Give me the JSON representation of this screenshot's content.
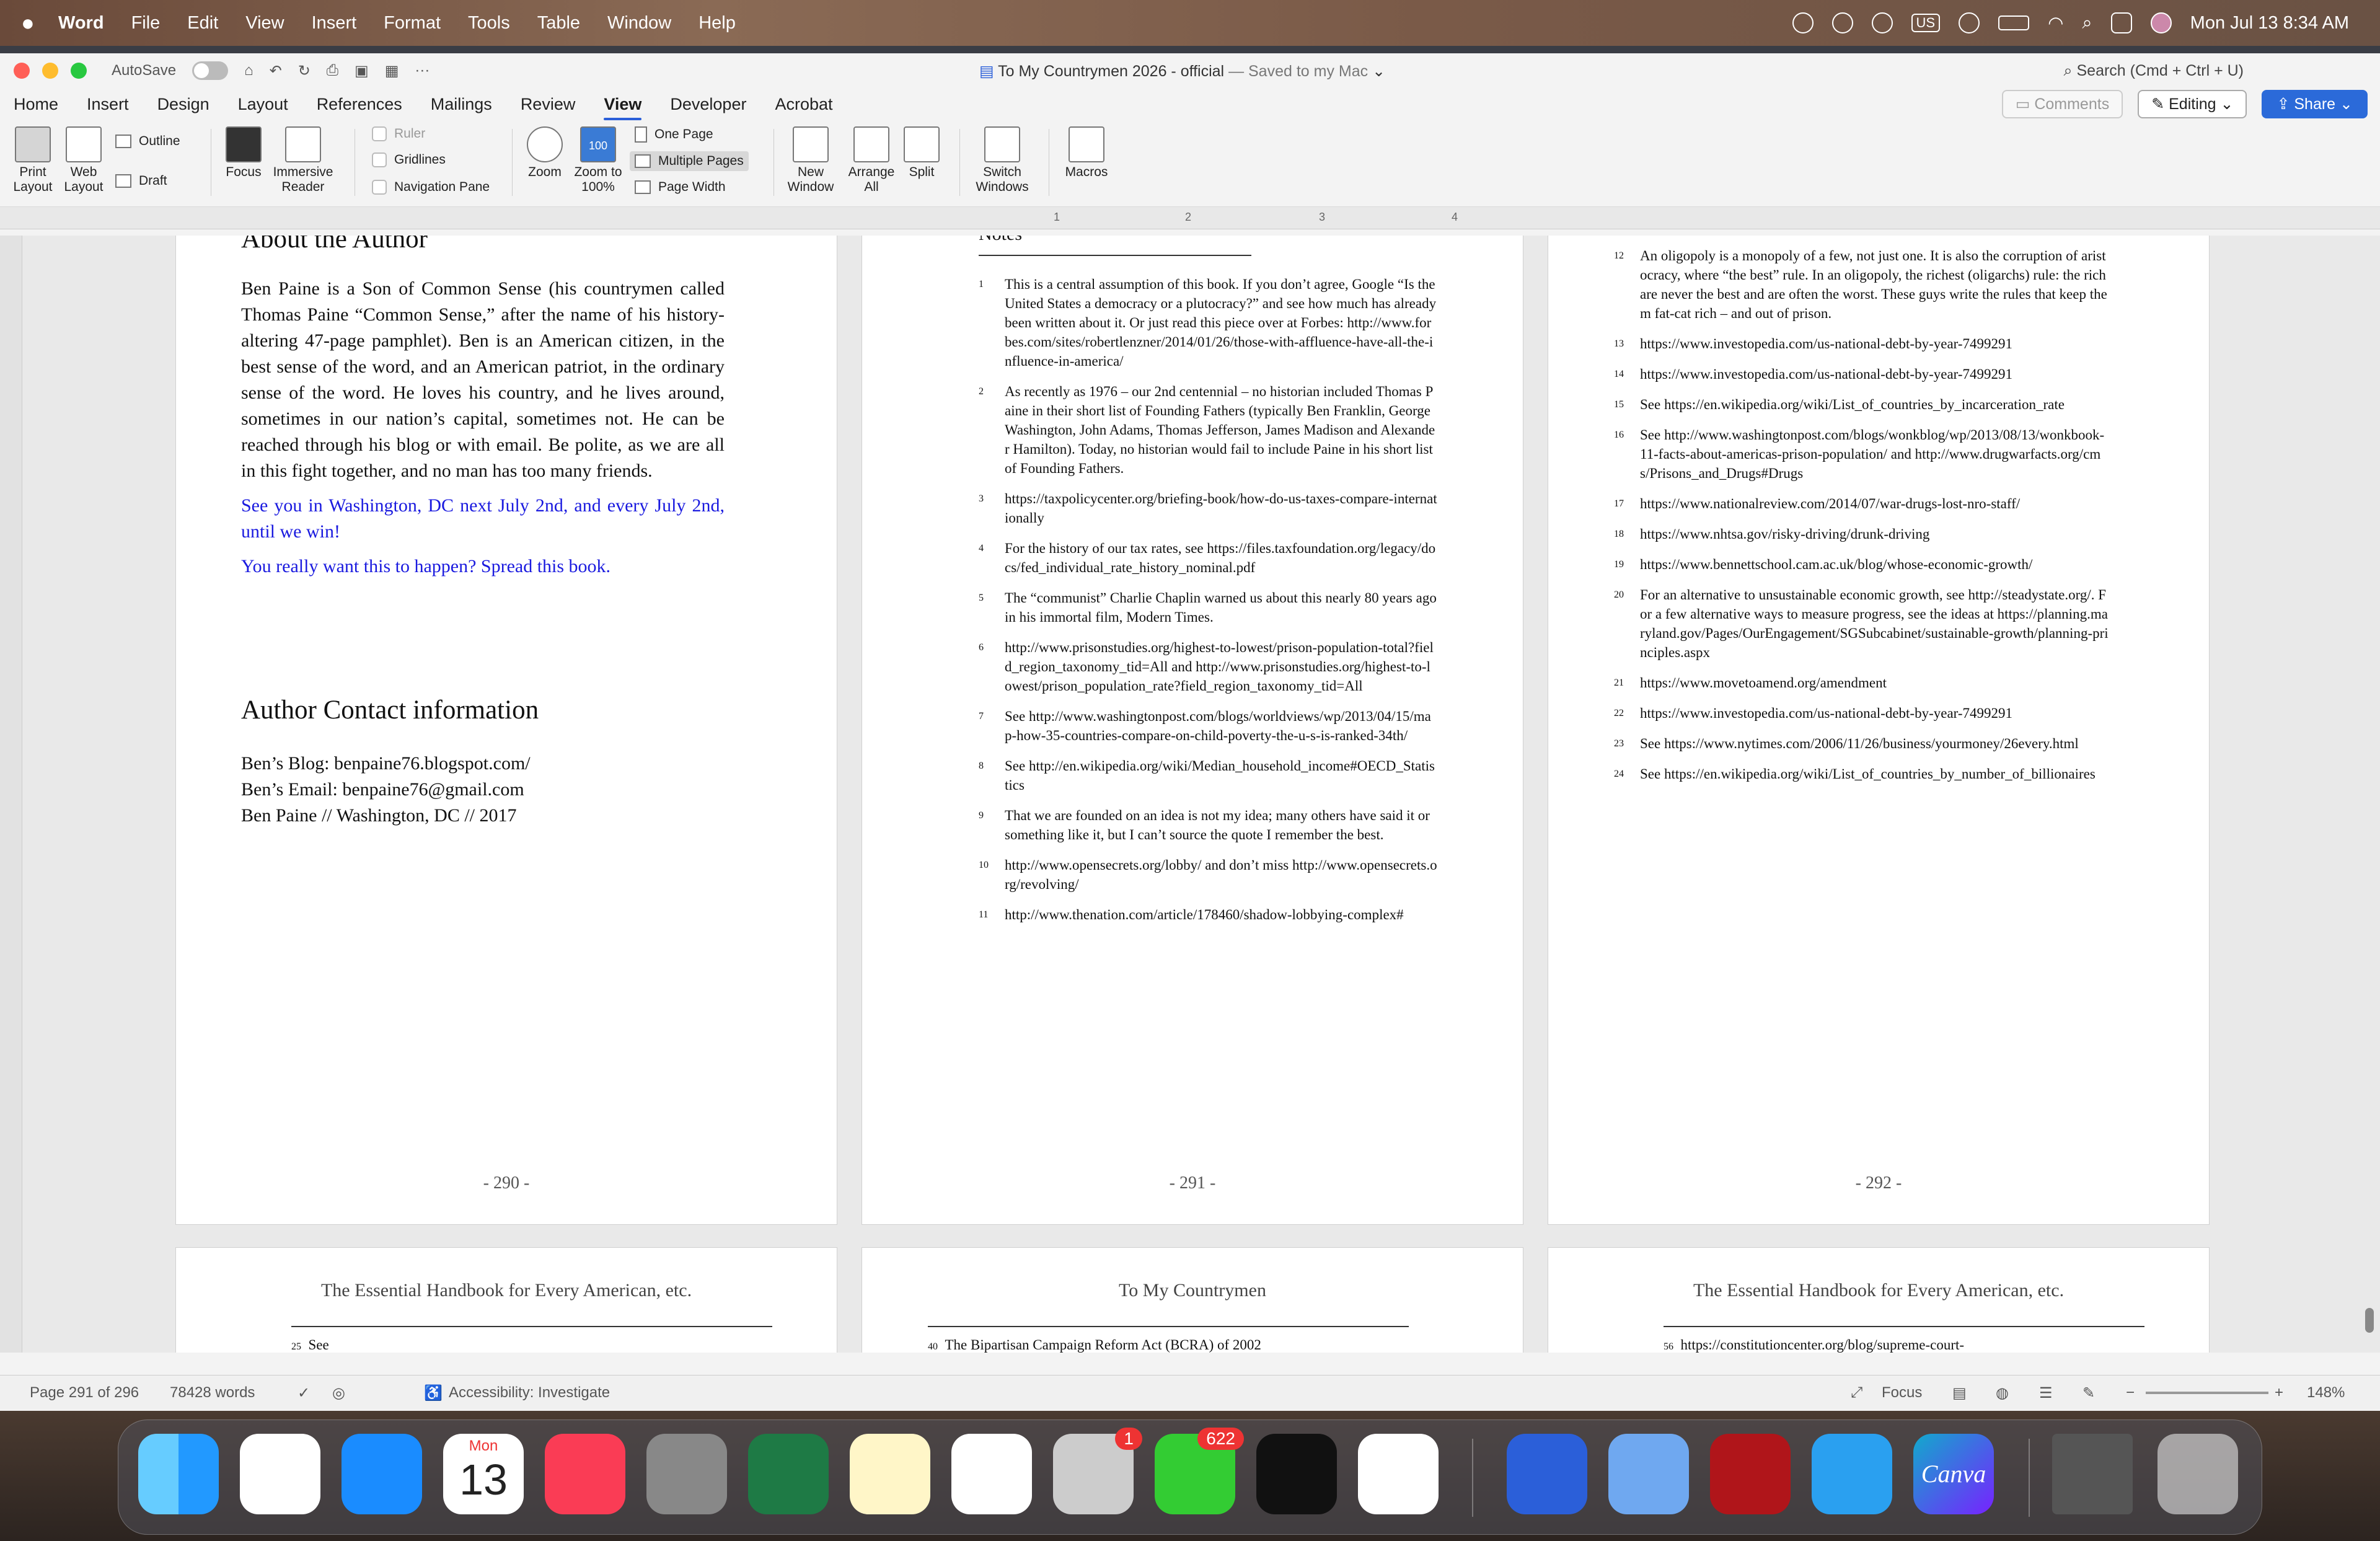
{
  "menubar": {
    "app": "Word",
    "items": [
      "File",
      "Edit",
      "View",
      "Insert",
      "Format",
      "Tools",
      "Table",
      "Window",
      "Help"
    ],
    "input": "US",
    "datetime": "Mon Jul 13  8:34 AM"
  },
  "titlebar": {
    "autosave": "AutoSave",
    "title": "To My Countrymen 2026 - official",
    "saved": "— Saved to my Mac",
    "search": "Search (Cmd + Ctrl + U)"
  },
  "tabs": [
    "Home",
    "Insert",
    "Design",
    "Layout",
    "References",
    "Mailings",
    "Review",
    "View",
    "Developer",
    "Acrobat"
  ],
  "active_tab": "View",
  "tab_buttons": {
    "comments": "Comments",
    "editing": "Editing",
    "share": "Share"
  },
  "ribbon": {
    "print_layout": "Print Layout",
    "web_layout": "Web Layout",
    "outline": "Outline",
    "draft": "Draft",
    "focus": "Focus",
    "immersive": "Immersive Reader",
    "ruler": "Ruler",
    "gridlines": "Gridlines",
    "navigation": "Navigation Pane",
    "zoom": "Zoom",
    "zoom100": "Zoom to 100%",
    "zoom100_icon_text": "100",
    "one_page": "One Page",
    "multiple_pages": "Multiple Pages",
    "page_width": "Page Width",
    "new_window": "New Window",
    "arrange_all": "Arrange All",
    "split": "Split",
    "switch_windows": "Switch Windows",
    "macros": "Macros"
  },
  "ruler_marks": [
    "1",
    "2",
    "3",
    "4"
  ],
  "page290": {
    "heading1": "About the Author",
    "body": "Ben Paine is a Son of Common Sense (his countrymen called Thomas Paine “Common Sense,” after the name of his history-altering 47-page pamphlet). Ben is an American citizen, in the best sense of the word, and an American patriot, in the ordinary sense of the word. He loves his country, and he lives around, sometimes in our nation’s capital, sometimes not. He can be reached through his blog or with email. Be polite, as we are all in this fight together, and no man has too many friends.",
    "blue1": "See you in Washington, DC next July 2nd, and every July 2nd, until we win!",
    "blue2": "You really want this to happen? Spread this book.",
    "heading2": "Author Contact information",
    "contact": [
      "Ben’s Blog: benpaine76.blogspot.com/",
      "Ben’s Email: benpaine76@gmail.com",
      "Ben Paine // Washington, DC // 2017"
    ],
    "num": "- 290 -"
  },
  "page291": {
    "heading": "Notes",
    "num": "- 291 -",
    "notes": [
      {
        "n": "1",
        "t": "This is a central assumption of this book. If you don’t agree, Google “Is the United States a democracy or a plutocracy?” and see how much has already been written about it. Or just read this piece over at Forbes: http://www.forbes.com/sites/robertlenzner/2014/01/26/those-with-affluence-have-all-the-influence-in-america/"
      },
      {
        "n": "2",
        "t": "As recently as 1976 – our 2nd centennial – no historian included Thomas Paine in their short list of Founding Fathers (typically Ben Franklin, George Washington, John Adams, Thomas Jefferson, James Madison and Alexander Hamilton). Today, no historian would fail to include Paine in his short list of Founding Fathers."
      },
      {
        "n": "3",
        "t": "https://taxpolicycenter.org/briefing-book/how-do-us-taxes-compare-internationally"
      },
      {
        "n": "4",
        "t": "For the history of our tax rates, see https://files.taxfoundation.org/legacy/docs/fed_individual_rate_history_nominal.pdf"
      },
      {
        "n": "5",
        "t": "The “communist” Charlie Chaplin warned us about this nearly 80 years ago in his immortal film, Modern Times."
      },
      {
        "n": "6",
        "t": "http://www.prisonstudies.org/highest-to-lowest/prison-population-total?field_region_taxonomy_tid=All and http://www.prisonstudies.org/highest-to-lowest/prison_population_rate?field_region_taxonomy_tid=All"
      },
      {
        "n": "7",
        "t": "See http://www.washingtonpost.com/blogs/worldviews/wp/2013/04/15/map-how-35-countries-compare-on-child-poverty-the-u-s-is-ranked-34th/"
      },
      {
        "n": "8",
        "t": "See http://en.wikipedia.org/wiki/Median_household_income#OECD_Statistics"
      },
      {
        "n": "9",
        "t": "That we are founded on an idea is not my idea; many others have said it or something like it, but I can’t source the quote I remember the best."
      },
      {
        "n": "10",
        "t": "http://www.opensecrets.org/lobby/ and don’t miss http://www.opensecrets.org/revolving/"
      },
      {
        "n": "11",
        "t": "http://www.thenation.com/article/178460/shadow-lobbying-complex#"
      }
    ]
  },
  "page292": {
    "num": "- 292 -",
    "notes": [
      {
        "n": "12",
        "t": "An oligopoly is a monopoly of a few, not just one. It is also the corruption of aristocracy, where “the best” rule. In an oligopoly, the richest (oligarchs) rule: the rich are never the best and are often the worst. These guys write the rules that keep them fat-cat rich – and out of prison."
      },
      {
        "n": "13",
        "t": "https://www.investopedia.com/us-national-debt-by-year-7499291"
      },
      {
        "n": "14",
        "t": "https://www.investopedia.com/us-national-debt-by-year-7499291"
      },
      {
        "n": "15",
        "t": "See https://en.wikipedia.org/wiki/List_of_countries_by_incarceration_rate"
      },
      {
        "n": "16",
        "t": "See http://www.washingtonpost.com/blogs/wonkblog/wp/2013/08/13/wonkbook-11-facts-about-americas-prison-population/ and http://www.drugwarfacts.org/cms/Prisons_and_Drugs#Drugs"
      },
      {
        "n": "17",
        "t": "https://www.nationalreview.com/2014/07/war-drugs-lost-nro-staff/"
      },
      {
        "n": "18",
        "t": "https://www.nhtsa.gov/risky-driving/drunk-driving"
      },
      {
        "n": "19",
        "t": "https://www.bennettschool.cam.ac.uk/blog/whose-economic-growth/"
      },
      {
        "n": "20",
        "t": "For an alternative to unsustainable economic growth, see http://steadystate.org/. For a few alternative ways to measure progress, see the ideas at https://planning.maryland.gov/Pages/OurEngagement/SGSubcabinet/sustainable-growth/planning-principles.aspx"
      },
      {
        "n": "21",
        "t": "https://www.movetoamend.org/amendment"
      },
      {
        "n": "22",
        "t": "https://www.investopedia.com/us-national-debt-by-year-7499291"
      },
      {
        "n": "23",
        "t": "See https://www.nytimes.com/2006/11/26/business/yourmoney/26every.html"
      },
      {
        "n": "24",
        "t": "See https://en.wikipedia.org/wiki/List_of_countries_by_number_of_billionaires"
      }
    ]
  },
  "lower": {
    "h1": "The Essential Handbook for Every American, etc.",
    "h2": "To My Countrymen",
    "h3": "The Essential Handbook for Every American, etc.",
    "n1": "25",
    "t1": "See",
    "n2": "40",
    "t2": "The Bipartisan Campaign Reform Act (BCRA) of 2002",
    "n3": "56",
    "t3": "https://constitutioncenter.org/blog/supreme-court-"
  },
  "status": {
    "page": "Page 291 of 296",
    "words": "78428 words",
    "accessibility": "Accessibility: Investigate",
    "focus": "Focus",
    "zoom": "148%"
  },
  "dock": {
    "calendar_month": "Mon",
    "calendar_day": "13",
    "badge_mail": "1",
    "badge_messages": "622",
    "canva": "Canva"
  }
}
